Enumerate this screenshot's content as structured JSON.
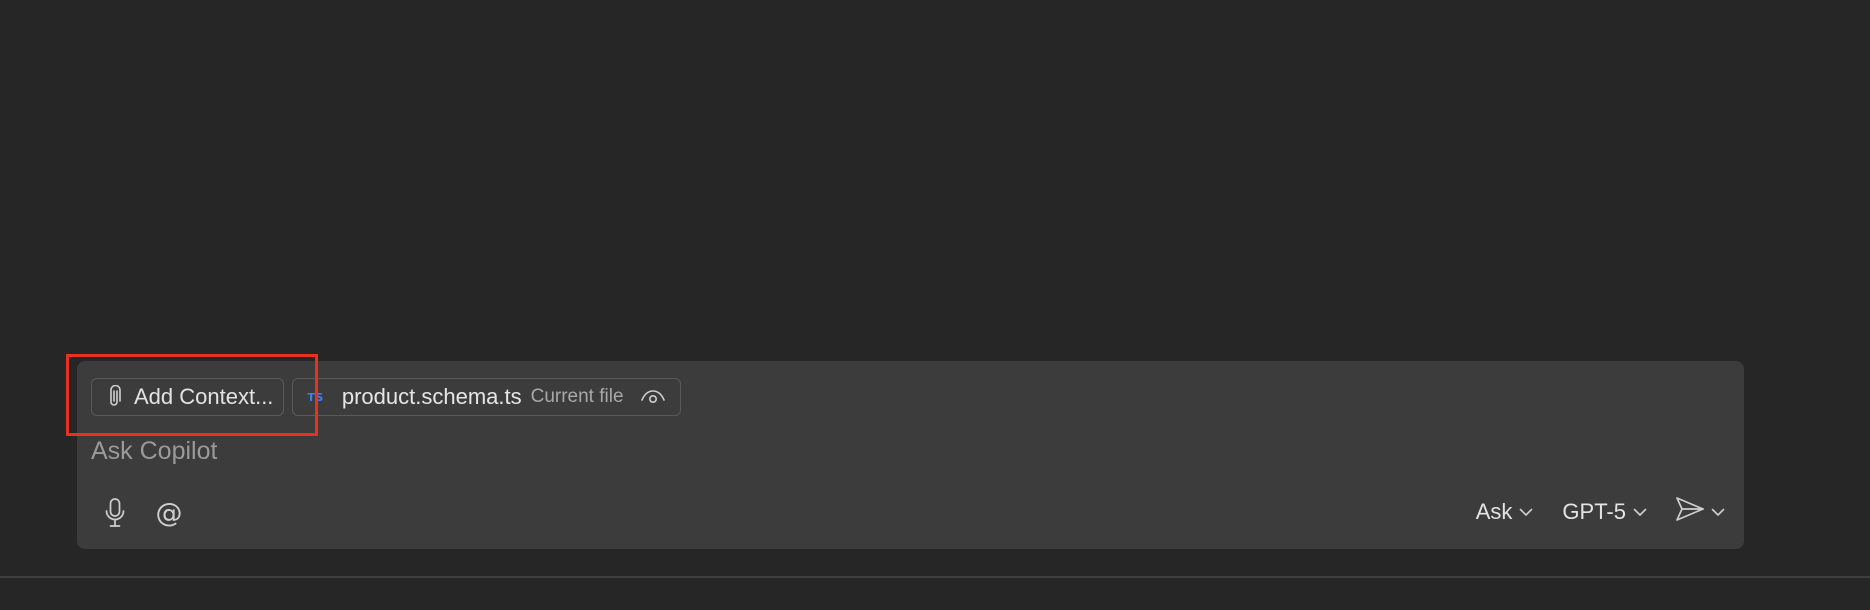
{
  "context_bar": {
    "add_context_label": "Add Context...",
    "add_context_icon": "paperclip-icon",
    "file_chip": {
      "type_badge": "TS",
      "file_name": "product.schema.ts",
      "note": "Current file",
      "visibility_icon": "eye-icon"
    }
  },
  "input": {
    "placeholder": "Ask Copilot",
    "value": ""
  },
  "toolbar": {
    "mic_icon": "microphone-icon",
    "mention_symbol": "@",
    "mode_label": "Ask",
    "model_label": "GPT-5",
    "send_icon": "send-icon"
  },
  "colors": {
    "background": "#262626",
    "panel": "#3c3c3c",
    "highlight": "#e8311e",
    "ts_badge": "#3b82f6"
  }
}
